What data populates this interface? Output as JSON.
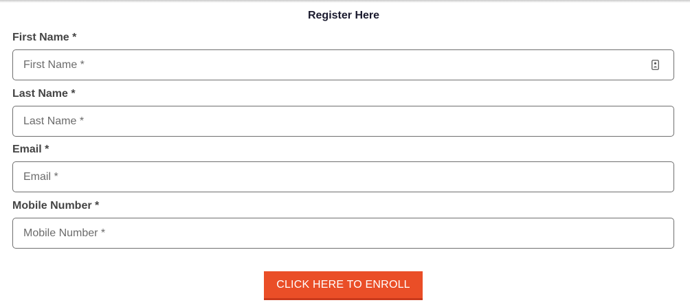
{
  "form": {
    "title": "Register Here",
    "fields": [
      {
        "label": "First Name *",
        "placeholder": "First Name *",
        "value": ""
      },
      {
        "label": "Last Name *",
        "placeholder": "Last Name *",
        "value": ""
      },
      {
        "label": "Email *",
        "placeholder": "Email *",
        "value": ""
      },
      {
        "label": "Mobile Number *",
        "placeholder": "Mobile Number *",
        "value": ""
      }
    ],
    "submit_label": "CLICK HERE TO ENROLL",
    "autofill_icon": "contact-card-icon"
  },
  "colors": {
    "button": "#ea4e27",
    "button_text": "#ffffff",
    "label": "#444444",
    "title": "#1a1a2e",
    "input_border": "#6e6e6e"
  }
}
